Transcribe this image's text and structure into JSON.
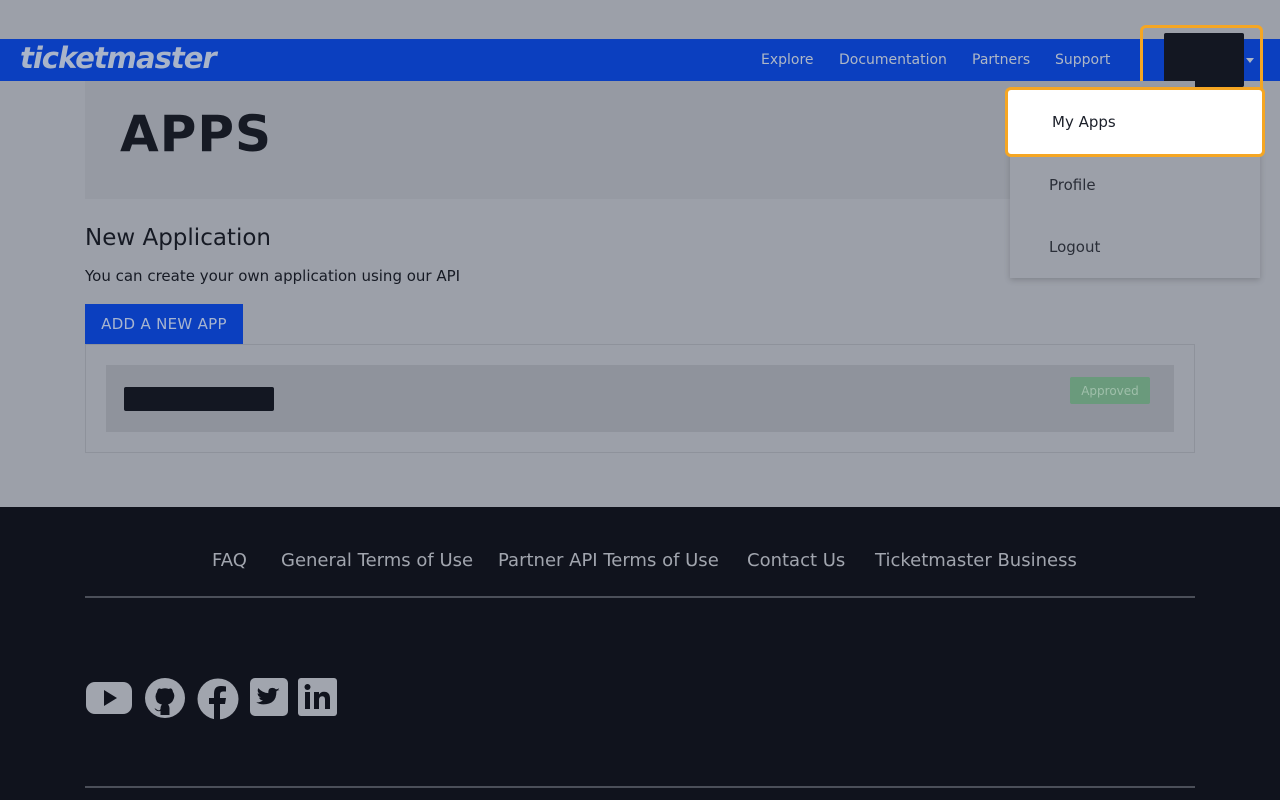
{
  "brand": {
    "logo_text": "ticketmaster"
  },
  "nav": {
    "links": [
      "Explore",
      "Documentation",
      "Partners",
      "Support"
    ]
  },
  "user_menu": {
    "items": [
      "My Apps",
      "Profile",
      "Logout"
    ],
    "highlighted": "My Apps"
  },
  "page": {
    "title": "APPS",
    "section_heading": "New Application",
    "section_description": "You can create your own application using our API",
    "add_button_label": "ADD A NEW APP"
  },
  "apps": [
    {
      "status": "Approved"
    }
  ],
  "footer": {
    "links": [
      "FAQ",
      "General Terms of Use",
      "Partner API Terms of Use",
      "Contact Us",
      "Ticketmaster Business"
    ],
    "social_icons": [
      "youtube-icon",
      "github-icon",
      "facebook-icon",
      "twitter-icon",
      "linkedin-icon"
    ]
  },
  "colors": {
    "brand_blue": "#0b3fbf",
    "highlight_orange": "#f5a623",
    "approved_green": "#6a9a7c",
    "footer_bg": "#10131d"
  }
}
